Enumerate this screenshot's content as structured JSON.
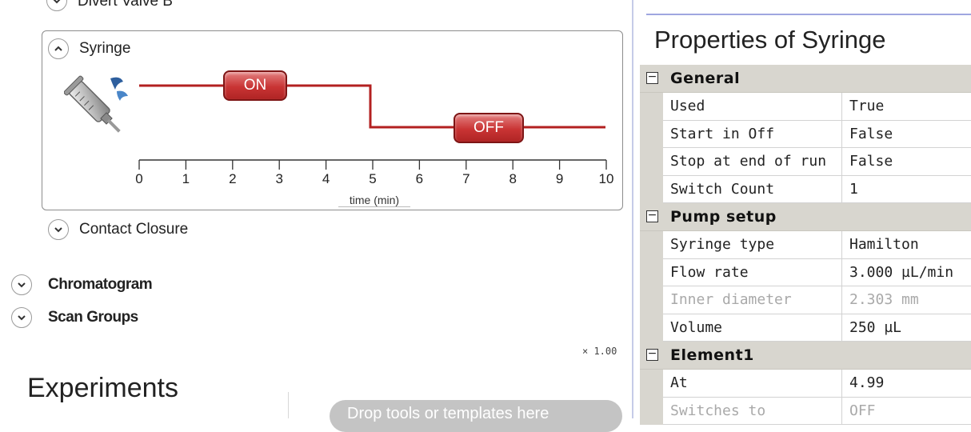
{
  "left": {
    "divert_valve_label": "Divert Valve B",
    "syringe_label": "Syringe",
    "contact_closure_label": "Contact Closure",
    "chromatogram_label": "Chromatogram",
    "scan_groups_label": "Scan Groups",
    "zoom": "× 1.00",
    "experiments_title": "Experiments",
    "drop_hint": "Drop tools or templates here"
  },
  "timeline": {
    "on_label": "ON",
    "off_label": "OFF",
    "xlabel": "time (min)",
    "ticks": [
      "0",
      "1",
      "2",
      "3",
      "4",
      "5",
      "6",
      "7",
      "8",
      "9",
      "10"
    ],
    "switch_at": 5,
    "start_state": "ON",
    "x_range": [
      0,
      10
    ],
    "line_color": "#b32020",
    "syringe_icon": "syringe-icon"
  },
  "properties": {
    "title": "Properties of Syringe",
    "categories": [
      {
        "name": "General",
        "rows": [
          {
            "name": "Used",
            "value": "True",
            "disabled": false
          },
          {
            "name": "Start in Off",
            "value": "False",
            "disabled": false
          },
          {
            "name": "Stop at end of run",
            "value": "False",
            "disabled": false
          },
          {
            "name": "Switch Count",
            "value": "1",
            "disabled": false
          }
        ]
      },
      {
        "name": "Pump setup",
        "rows": [
          {
            "name": "Syringe type",
            "value": "Hamilton",
            "disabled": false
          },
          {
            "name": "Flow rate",
            "value": "3.000 µL/min",
            "disabled": false
          },
          {
            "name": "Inner diameter",
            "value": "2.303 mm",
            "disabled": true
          },
          {
            "name": "Volume",
            "value": "250 µL",
            "disabled": false
          }
        ]
      },
      {
        "name": "Element1",
        "rows": [
          {
            "name": "At",
            "value": "4.99",
            "disabled": false
          },
          {
            "name": "Switches to",
            "value": "OFF",
            "disabled": true
          }
        ]
      }
    ]
  },
  "colors": {
    "accent_red": "#c93434",
    "category_bg": "#d8d6cf",
    "divider_blue": "#9fa6e0"
  }
}
